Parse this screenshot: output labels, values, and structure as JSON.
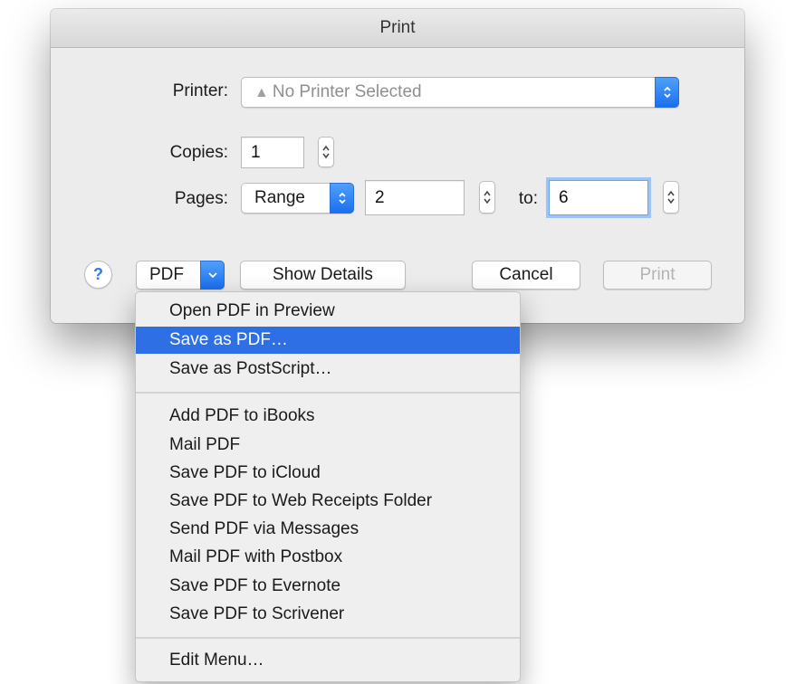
{
  "dialog": {
    "title": "Print",
    "printer": {
      "label": "Printer:",
      "value": "No Printer Selected",
      "icon": "warning-icon"
    },
    "copies": {
      "label": "Copies:",
      "value": "1"
    },
    "pages": {
      "label": "Pages:",
      "mode": "Range",
      "from": "2",
      "to_label": "to:",
      "to": "6"
    },
    "footer": {
      "help": "?",
      "pdf": "PDF",
      "show_details": "Show Details",
      "cancel": "Cancel",
      "print": "Print"
    }
  },
  "pdf_menu": {
    "selected": "Save as PDF…",
    "groups": [
      [
        "Open PDF in Preview",
        "Save as PDF…",
        "Save as PostScript…"
      ],
      [
        "Add PDF to iBooks",
        "Mail PDF",
        "Save PDF to iCloud",
        "Save PDF to Web Receipts Folder",
        "Send PDF via Messages",
        "Mail PDF with Postbox",
        "Save PDF to Evernote",
        "Save PDF to Scrivener"
      ],
      [
        "Edit Menu…"
      ]
    ]
  },
  "colors": {
    "accent": "#2e6fe6",
    "dialog_bg": "#ececec",
    "menu_bg": "#efefef"
  }
}
